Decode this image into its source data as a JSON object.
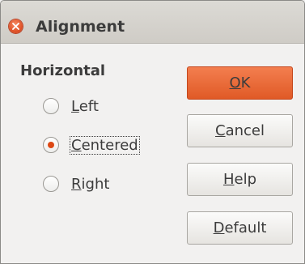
{
  "window": {
    "title": "Alignment"
  },
  "horizontal": {
    "label": "Horizontal",
    "options": [
      {
        "first": "L",
        "rest": "eft",
        "checked": false
      },
      {
        "first": "C",
        "rest": "entered",
        "checked": true
      },
      {
        "first": "R",
        "rest": "ight",
        "checked": false
      }
    ]
  },
  "buttons": {
    "ok": {
      "first": "O",
      "rest": "K"
    },
    "cancel": {
      "first": "C",
      "rest": "ancel"
    },
    "help": {
      "first": "H",
      "rest": "elp"
    },
    "default": {
      "first": "D",
      "rest": "efault"
    }
  },
  "colors": {
    "accent": "#dd4814",
    "button_default": "#e9672f"
  }
}
